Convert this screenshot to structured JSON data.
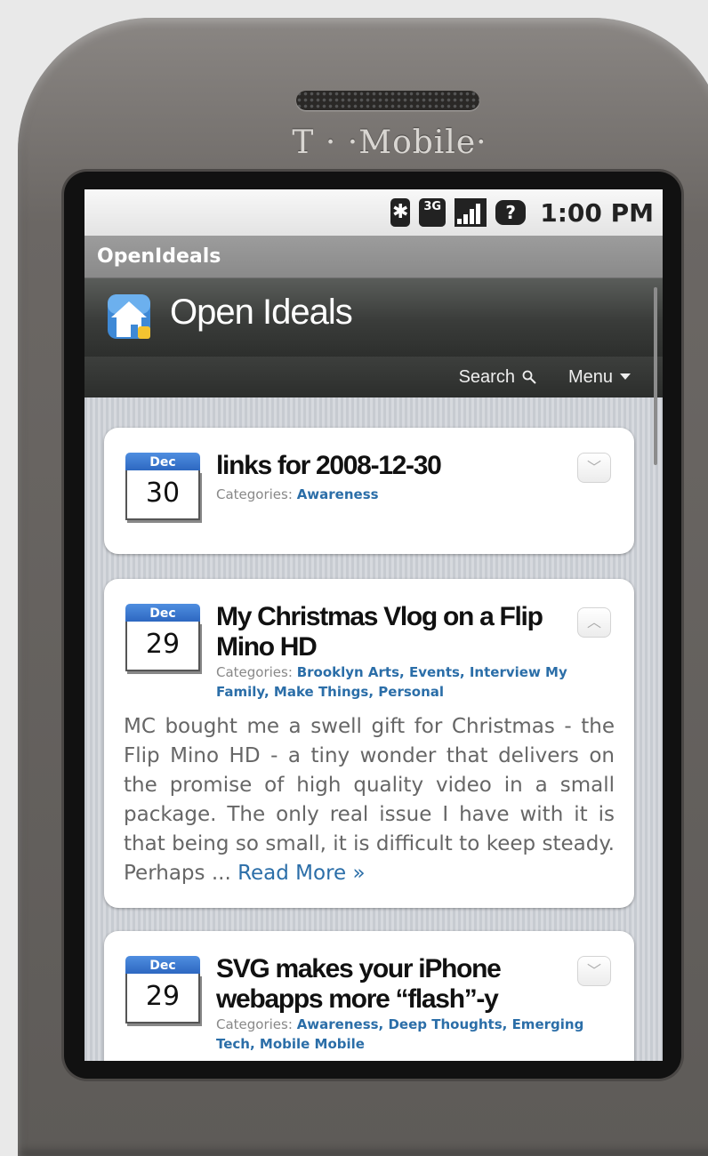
{
  "device": {
    "brand": "T · ·Mobile·"
  },
  "statusbar": {
    "time": "1:00 PM",
    "bluetooth_icon": "bluetooth-icon",
    "network_label": "3G",
    "battery_label": "?"
  },
  "app": {
    "title": "OpenIdeals"
  },
  "site": {
    "title": "Open Ideals",
    "nav": {
      "search_label": "Search",
      "menu_label": "Menu"
    }
  },
  "posts": [
    {
      "month": "Dec",
      "day": "30",
      "title": "links for 2008-12-30",
      "categories_label": "Categories:",
      "categories": "Awareness",
      "expanded": false
    },
    {
      "month": "Dec",
      "day": "29",
      "title": "My Christmas Vlog on a Flip Mino HD",
      "categories_label": "Categories:",
      "categories": "Brooklyn Arts, Events, Interview My Family, Make Things, Personal",
      "excerpt": "MC bought me a swell gift for Christmas - the Flip Mino HD - a tiny wonder that delivers on the promise of high quality video in a small package. The only real issue I have with it is that being so small, it is difficult to keep steady. Perhaps ...",
      "read_more": "Read More »",
      "expanded": true
    },
    {
      "month": "Dec",
      "day": "29",
      "title": "SVG makes your iPhone webapps more “flash”-y",
      "categories_label": "Categories:",
      "categories": "Awareness, Deep Thoughts, Emerging Tech, Mobile Mobile",
      "expanded": false
    }
  ]
}
